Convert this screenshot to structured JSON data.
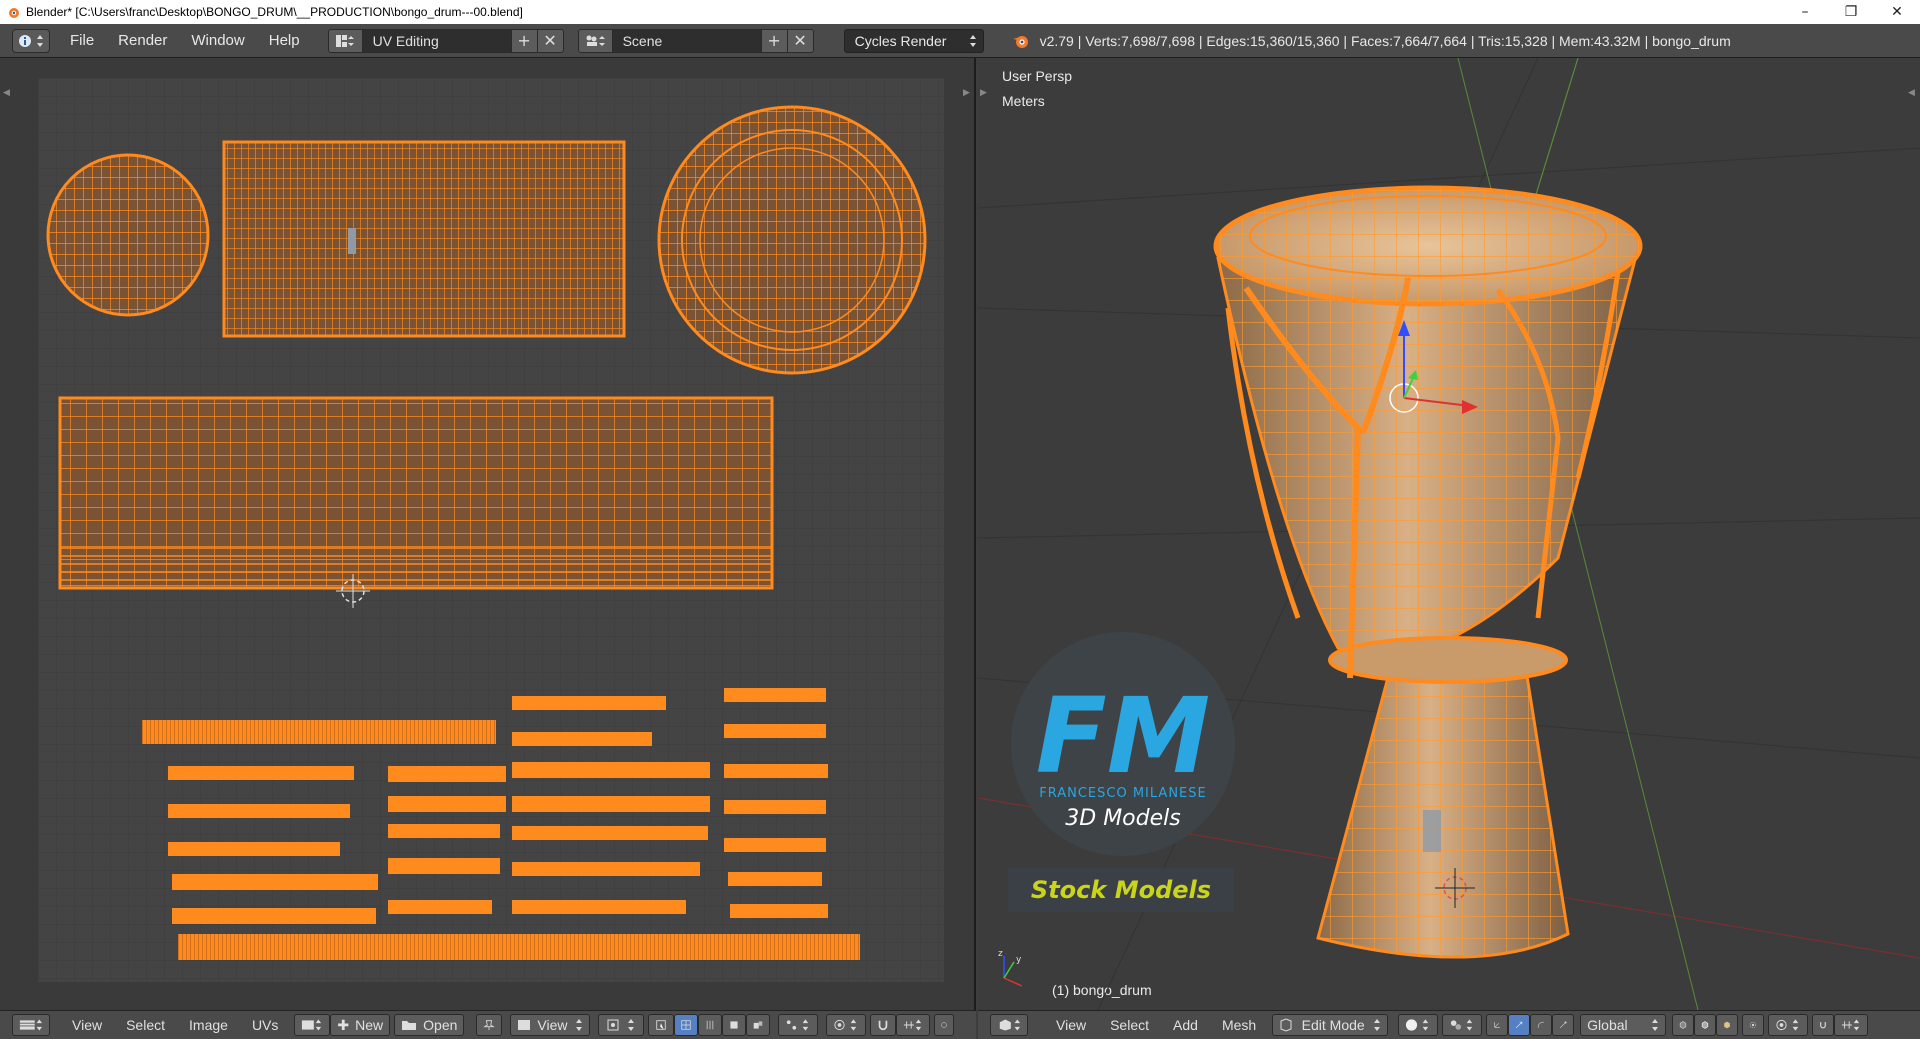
{
  "window": {
    "title": "Blender* [C:\\Users\\franc\\Desktop\\BONGO_DRUM\\__PRODUCTION\\bongo_drum---00.blend]",
    "minimize": "–",
    "restore": "❐",
    "close": "✕"
  },
  "info_header": {
    "menus": [
      "File",
      "Render",
      "Window",
      "Help"
    ],
    "layout": {
      "value": "UV Editing",
      "add": "+",
      "remove": "✕"
    },
    "scene": {
      "value": "Scene",
      "add": "+",
      "remove": "✕"
    },
    "render_engine": "Cycles Render",
    "stats": "v2.79 | Verts:7,698/7,698 | Edges:15,360/15,360 | Faces:7,664/7,664 | Tris:15,328 | Mem:43.32M | bongo_drum"
  },
  "viewport": {
    "view_name": "User Persp",
    "units": "Meters",
    "object_label": "(1) bongo_drum"
  },
  "logo": {
    "letters": "FM",
    "name": "FRANCESCO MILANESE",
    "tagline": "3D Models",
    "badge": "Stock Models"
  },
  "uv_footer": {
    "menus": [
      "View",
      "Select",
      "Image",
      "UVs"
    ],
    "new_label": "New",
    "open_label": "Open",
    "view_label": "View"
  },
  "vp_footer": {
    "menus": [
      "View",
      "Select",
      "Add",
      "Mesh"
    ],
    "mode": "Edit Mode",
    "orientation": "Global"
  },
  "colors": {
    "accent_orange": "#ff8a1e",
    "mesh_fill": "#c99a6a",
    "uv_fill": "#7a5334",
    "logo_blue": "#2aa6e0",
    "badge_yellow": "#c9d41a"
  }
}
